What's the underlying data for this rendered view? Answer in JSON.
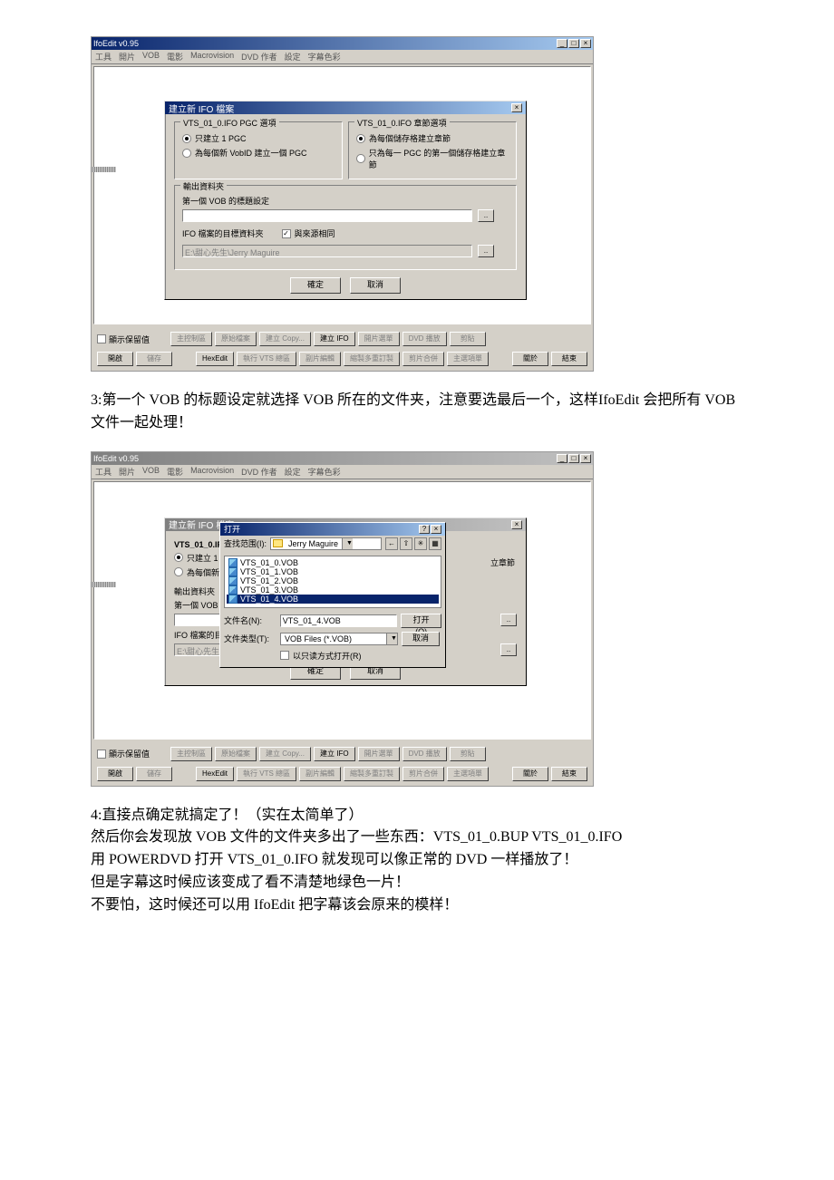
{
  "win": {
    "title": "IfoEdit v0.95",
    "menu": [
      "工具",
      "開片",
      "VOB",
      "電影",
      "Macrovision",
      "DVD 作者",
      "設定",
      "字幕色彩"
    ]
  },
  "dialog1": {
    "title": "建立新 IFO 檔案",
    "grp_pgc_title": "VTS_01_0.IFO PGC 選項",
    "grp_chap_title": "VTS_01_0.IFO 章節選項",
    "r_pgc1": "只建立 1 PGC",
    "r_pgc2": "為每個新 VobID 建立一個 PGC",
    "r_chap1": "為每個儲存格建立章節",
    "r_chap2": "只為每一 PGC 的第一個儲存格建立章節",
    "grp_out_title": "輸出資料夾",
    "lbl_firstvob": "第一個 VOB 的標題設定",
    "lbl_ifodir": "IFO 檔案的目標資料夾",
    "chk_same": "與來源相同",
    "path_disabled": "E:\\甜心先生\\Jerry Maguire",
    "btn_ok": "確定",
    "btn_cancel": "取消",
    "close": "×"
  },
  "bottom": {
    "chk_label": "顯示保留值",
    "btns": [
      "主控制區",
      "原始檔案",
      "建立 Copy...",
      "建立 IFO",
      "開片選單",
      "DVD 播放",
      "剪貼",
      "HexEdit",
      "執行 VTS 總區",
      "副片編輯",
      "縮製多重訂製",
      "剪片合併",
      "主選項單",
      "關於",
      "結束"
    ]
  },
  "text_3": "3:第一个 VOB 的标题设定就选择 VOB 所在的文件夹，注意要选最后一个，这样IfoEdit 会把所有 VOB 文件一起处理！",
  "opendlg": {
    "title": "打开",
    "look_lbl": "查找范围(I):",
    "folder": "Jerry Maguire",
    "files": [
      "VTS_01_0.VOB",
      "VTS_01_1.VOB",
      "VTS_01_2.VOB",
      "VTS_01_3.VOB",
      "VTS_01_4.VOB"
    ],
    "selected": "VTS_01_4.VOB",
    "fname_lbl": "文件名(N):",
    "ftype_lbl": "文件类型(T):",
    "ftype_val": "VOB Files (*.VOB)",
    "ro_chk": "以只读方式打开(R)",
    "btn_open": "打开(O)",
    "btn_cancel": "取消",
    "help": "?",
    "close": "×"
  },
  "dialog2_trunc": {
    "r1": "只建立 1 |",
    "r2": "為每個新",
    "out": "輸出資料夾",
    "firstvob": "第一個 VOB 的",
    "ifodir": "IFO 檔案的目",
    "path": "E:\\甜心先生\\J",
    "chap_end": "立章節"
  },
  "text_4_lines": [
    "4:直接点确定就搞定了！（实在太简单了）",
    "然后你会发现放 VOB 文件的文件夹多出了一些东西：VTS_01_0.BUP VTS_01_0.IFO",
    "用 POWERDVD 打开 VTS_01_0.IFO 就发现可以像正常的 DVD 一样播放了！",
    "但是字幕这时候应该变成了看不清楚地绿色一片！",
    "不要怕，这时候还可以用 IfoEdit 把字幕该会原来的模样！"
  ]
}
